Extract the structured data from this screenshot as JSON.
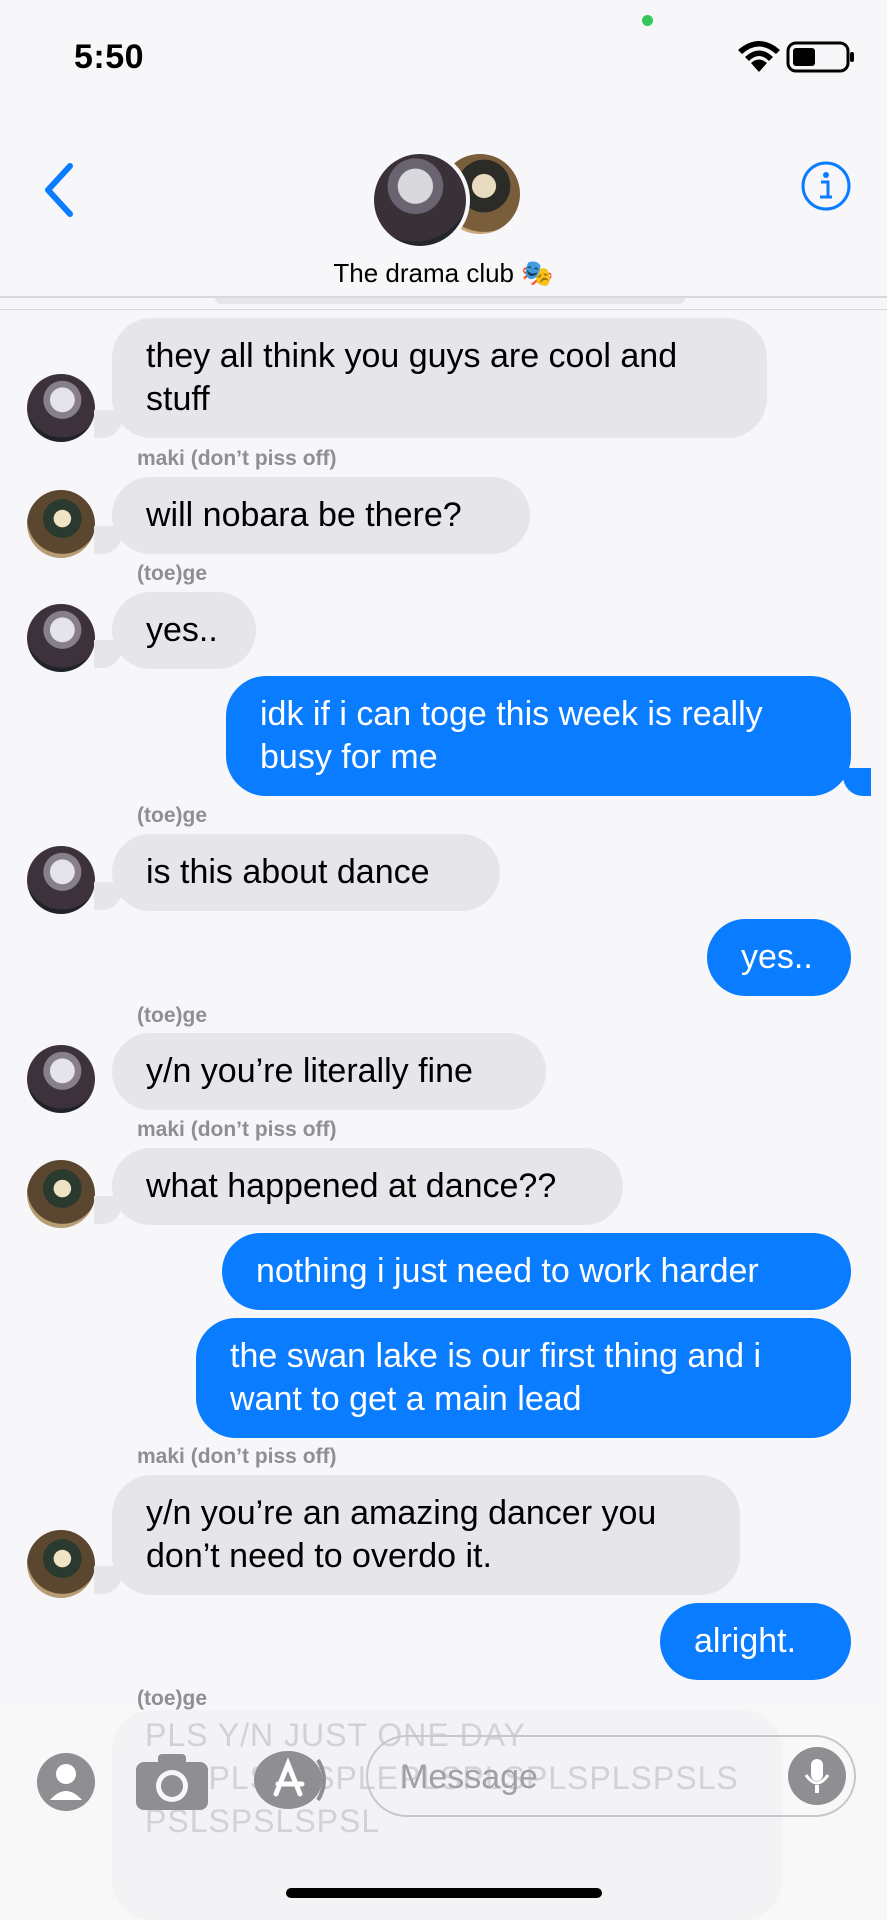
{
  "status": {
    "time": "5:50"
  },
  "header": {
    "chat_name": "The drama club 🎭"
  },
  "messages": [
    {
      "side": "in",
      "sender": "",
      "avatar": "toge",
      "text": "they all think you guys are cool and stuff"
    },
    {
      "side": "in",
      "sender": "maki (don’t piss off)",
      "avatar": "maki",
      "text": "will nobara be there?"
    },
    {
      "side": "in",
      "sender": "(toe)ge",
      "avatar": "toge",
      "text": "yes.."
    },
    {
      "side": "out",
      "text": "idk if i can toge this week is really busy for me"
    },
    {
      "side": "in",
      "sender": "(toe)ge",
      "avatar": "toge",
      "text": "is this about dance"
    },
    {
      "side": "out",
      "text": "yes.."
    },
    {
      "side": "in",
      "sender": "(toe)ge",
      "avatar": "toge",
      "text": "y/n you’re literally fine"
    },
    {
      "side": "in",
      "sender": "maki (don’t piss off)",
      "avatar": "maki",
      "text": "what happened at dance??"
    },
    {
      "side": "out",
      "text": "nothing i just need to work harder"
    },
    {
      "side": "out",
      "text": "the swan lake is our first thing and i want to get a main lead"
    },
    {
      "side": "in",
      "sender": "maki (don’t piss off)",
      "avatar": "maki",
      "text": "y/n you’re an amazing dancer you don’t need to overdo it."
    },
    {
      "side": "out",
      "text": "alright."
    },
    {
      "side": "in",
      "sender": "(toe)ge",
      "avatar": "toge",
      "text": "PLS Y/N JUST ONE DAY PLSPLSPLSPLEPLSPLSPLSPLSPSLS PSLSPSLSPSL"
    }
  ],
  "composer": {
    "placeholder": "Message"
  },
  "icons": {
    "back": "chevron-left-icon",
    "info": "info-icon",
    "apps": "app-store-icon",
    "camera": "camera-icon",
    "contact": "contact-icon",
    "mic": "microphone-icon"
  },
  "colors": {
    "outgoing": "#0a7cff",
    "incoming": "#e5e5ea",
    "accent": "#0a7cff"
  }
}
